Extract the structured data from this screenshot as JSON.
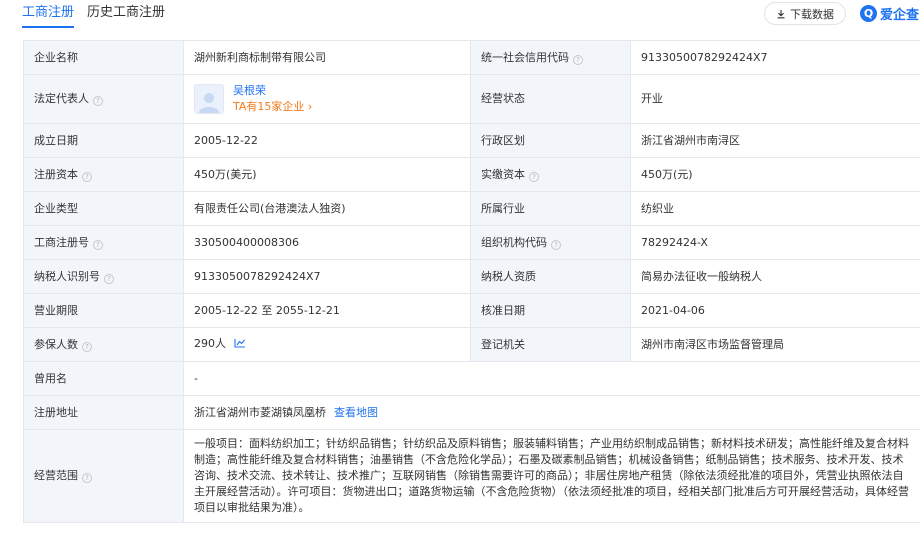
{
  "tabs": [
    {
      "label": "工商注册",
      "active": true
    },
    {
      "label": "历史工商注册",
      "active": false
    }
  ],
  "toolbar": {
    "download_label": "下载数据",
    "brand_label": "爱企查"
  },
  "rows": [
    {
      "l1": "企业名称",
      "v1": "湖州新利商标制带有限公司",
      "l2": "统一社会信用代码",
      "v2": "9133050078292424X7"
    },
    {
      "l1": "法定代表人",
      "rep_name": "吴根荣",
      "rep_link": "TA有15家企业",
      "l2": "经营状态",
      "v2": "开业"
    },
    {
      "l1": "成立日期",
      "v1": "2005-12-22",
      "l2": "行政区划",
      "v2": "浙江省湖州市南浔区"
    },
    {
      "l1": "注册资本",
      "v1": "450万(美元)",
      "l2": "实缴资本",
      "v2": "450万(元)"
    },
    {
      "l1": "企业类型",
      "v1": "有限责任公司(台港澳法人独资)",
      "l2": "所属行业",
      "v2": "纺织业"
    },
    {
      "l1": "工商注册号",
      "v1": "330500400008306",
      "l2": "组织机构代码",
      "v2": "78292424-X"
    },
    {
      "l1": "纳税人识别号",
      "v1": "9133050078292424X7",
      "l2": "纳税人资质",
      "v2": "简易办法征收一般纳税人"
    },
    {
      "l1": "营业期限",
      "v1": "2005-12-22 至 2055-12-21",
      "l2": "核准日期",
      "v2": "2021-04-06"
    },
    {
      "l1": "参保人数",
      "v1": "290人",
      "l2": "登记机关",
      "v2": "湖州市南浔区市场监督管理局"
    },
    {
      "l1": "曾用名",
      "v1": "-"
    },
    {
      "l1": "注册地址",
      "v1": "浙江省湖州市菱湖镇凤凰桥",
      "v1_link": "查看地图"
    },
    {
      "l1": "经营范围",
      "v1": "一般项目：面料纺织加工；针纺织品销售；针纺织品及原料销售；服装辅料销售；产业用纺织制成品销售；新材料技术研发；高性能纤维及复合材料制造；高性能纤维及复合材料销售；油墨销售（不含危险化学品）；石墨及碳素制品销售；机械设备销售；纸制品销售；技术服务、技术开发、技术咨询、技术交流、技术转让、技术推广；互联网销售（除销售需要许可的商品）；非居住房地产租赁（除依法须经批准的项目外，凭营业执照依法自主开展经营活动）。许可项目：货物进出口；道路货物运输（不含危险货物）（依法须经批准的项目，经相关部门批准后方可开展经营活动，具体经营项目以审批结果为准）。"
    }
  ]
}
